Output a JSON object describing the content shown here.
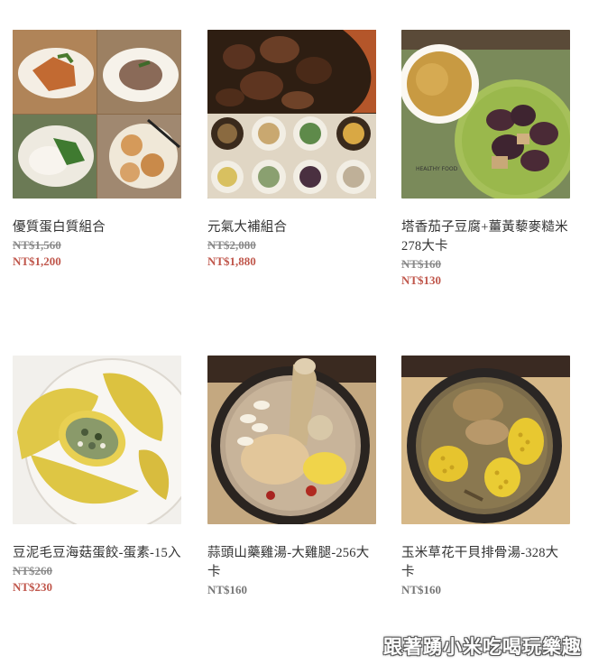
{
  "products": [
    {
      "title": "優質蛋白質組合",
      "old_price": "NT$1,560",
      "new_price": "NT$1,200"
    },
    {
      "title": "元氣大補組合",
      "old_price": "NT$2,080",
      "new_price": "NT$1,880"
    },
    {
      "title": "塔香茄子豆腐+薑黃藜麥糙米 278大卡",
      "old_price": "NT$160",
      "new_price": "NT$130"
    },
    {
      "title": "豆泥毛豆海菇蛋餃-蛋素-15入",
      "old_price": "NT$260",
      "new_price": "NT$230"
    },
    {
      "title": "蒜頭山藥雞湯-大雞腿-256大卡",
      "price": "NT$160"
    },
    {
      "title": "玉米草花干貝排骨湯-328大卡",
      "price": "NT$160"
    }
  ],
  "watermark": "跟著踴小米吃喝玩樂趣"
}
